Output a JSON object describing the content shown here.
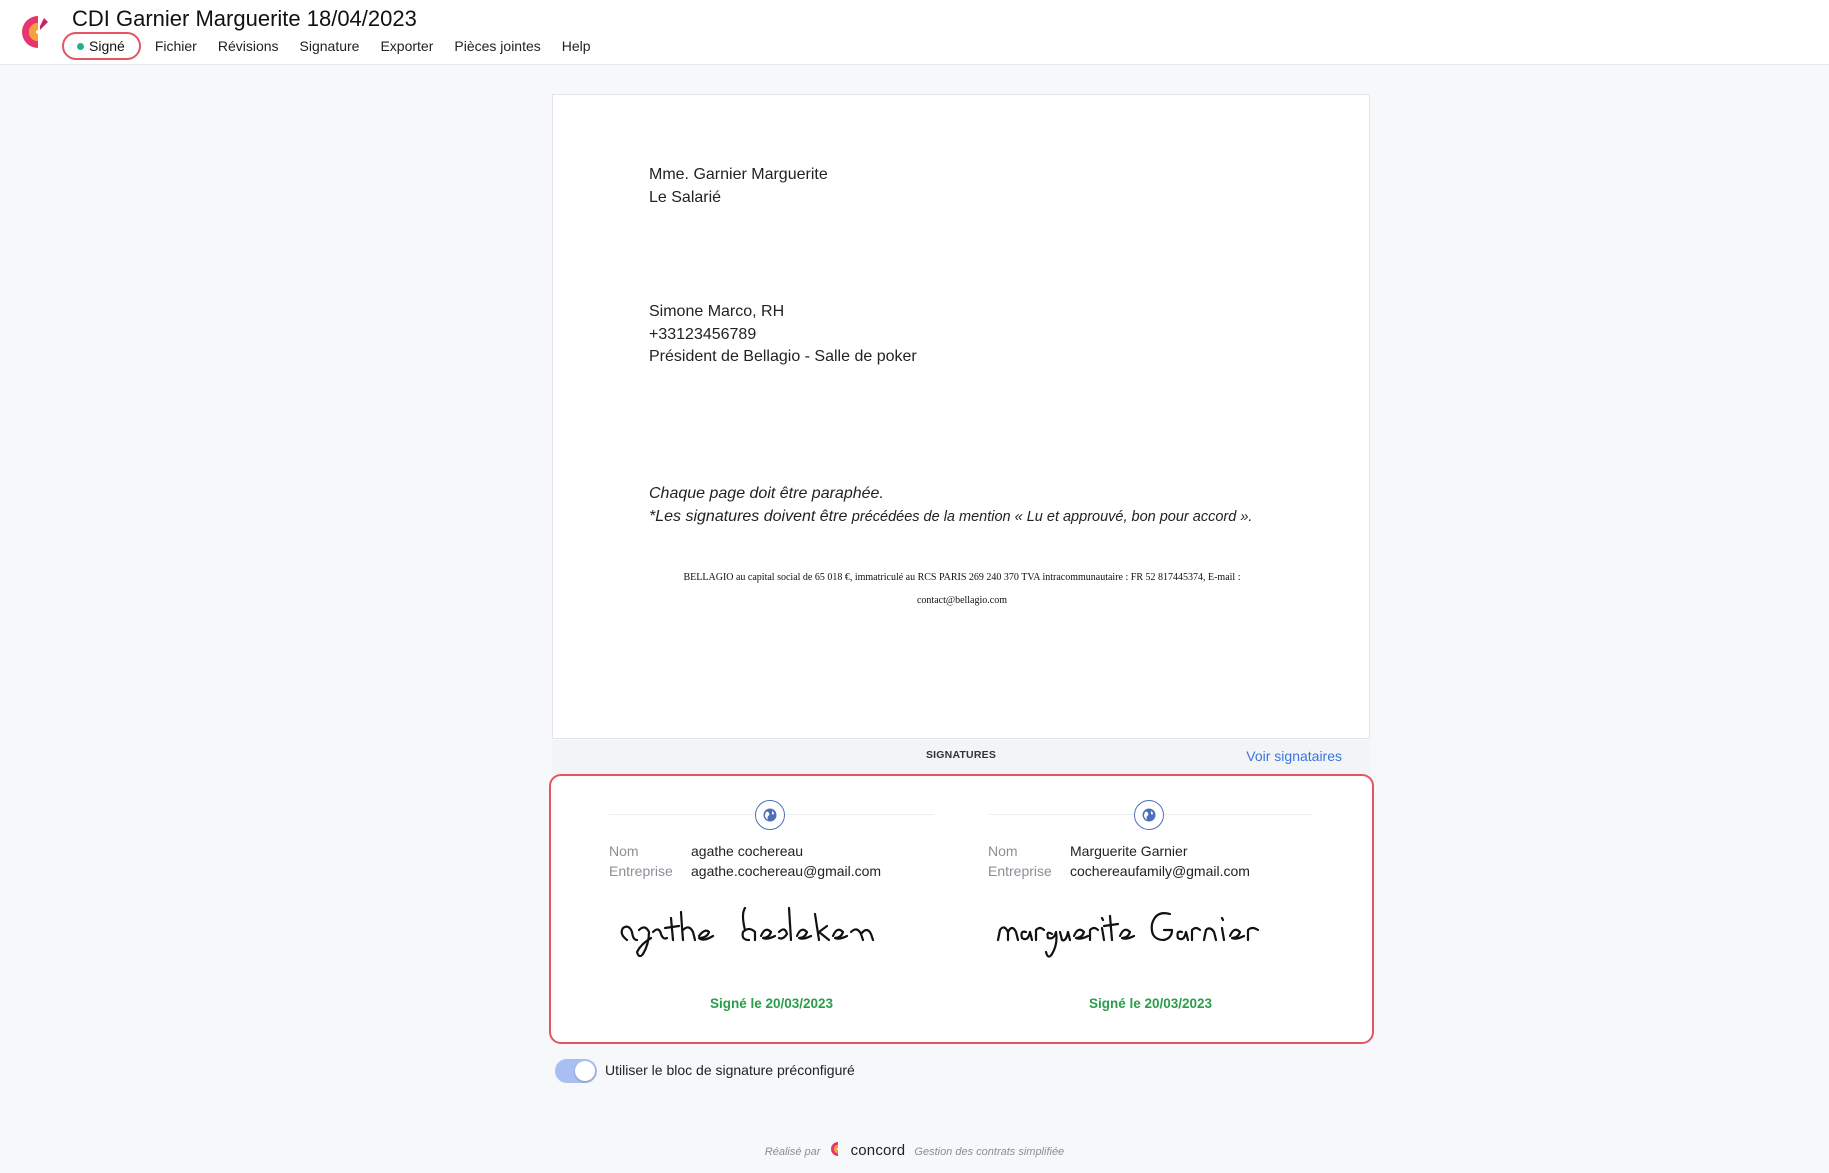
{
  "header": {
    "title": "CDI Garnier Marguerite 18/04/2023",
    "status": {
      "label": "Signé",
      "color": "#27b089"
    },
    "menu": [
      "Fichier",
      "Révisions",
      "Signature",
      "Exporter",
      "Pièces jointes",
      "Help"
    ]
  },
  "document": {
    "recipient_name": "Mme. Garnier Marguerite",
    "recipient_role": "Le Salarié",
    "signer_name": "Simone Marco, RH",
    "signer_phone": "+33123456789",
    "signer_role": "Président de Bellagio - Salle de poker",
    "note_line1": "Chaque page doit être paraphée.",
    "note_line2_part1": "*Les signatures doivent être",
    "note_line2_part2": "précédées de la mention « Lu et approuvé, bon pour accord ».",
    "legal_line1": "BELLAGIO au capital social de 65 018 €, immatriculé au RCS PARIS 269 240 370 TVA intracommunautaire : FR 52 817445374, E-mail :",
    "legal_line2": "contact@bellagio.com"
  },
  "signatures": {
    "title": "SIGNATURES",
    "view_link": "Voir signataires",
    "name_label": "Nom",
    "company_label": "Entreprise",
    "signers": [
      {
        "name": "agathe cochereau",
        "company": "agathe.cochereau@gmail.com",
        "handwritten": "agathe badakan",
        "signed": "Signé le 20/03/2023"
      },
      {
        "name": "Marguerite Garnier",
        "company": "cochereaufamily@gmail.com",
        "handwritten": "Marguerite Garnier",
        "signed": "Signé le 20/03/2023"
      }
    ]
  },
  "toggle": {
    "label": "Utiliser le bloc de signature préconfiguré",
    "on": true
  },
  "footer": {
    "prefix": "Réalisé par",
    "brand": "concord",
    "tagline": "Gestion des contrats simplifiée"
  },
  "colors": {
    "accent": "#e25561",
    "signed": "#2a9d4a",
    "link": "#3a76e0",
    "toggle": "#a9bff3"
  }
}
